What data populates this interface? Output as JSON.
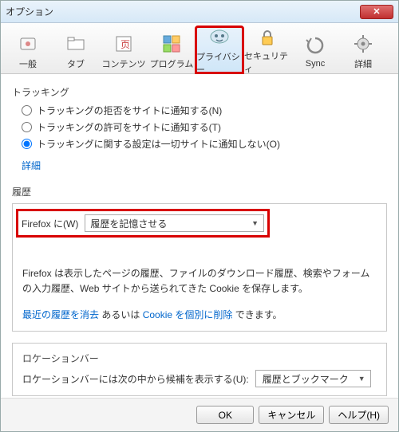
{
  "window": {
    "title": "オプション"
  },
  "tabs": [
    {
      "label": "一般"
    },
    {
      "label": "タブ"
    },
    {
      "label": "コンテンツ"
    },
    {
      "label": "プログラム"
    },
    {
      "label": "プライバシー"
    },
    {
      "label": "セキュリティ"
    },
    {
      "label": "Sync"
    },
    {
      "label": "詳細"
    }
  ],
  "tracking": {
    "title": "トラッキング",
    "opt1": "トラッキングの拒否をサイトに通知する(N)",
    "opt2": "トラッキングの許可をサイトに通知する(T)",
    "opt3": "トラッキングに関する設定は一切サイトに通知しない(O)",
    "details": "詳細"
  },
  "history": {
    "title": "履歴",
    "prefix": "Firefox に(W)",
    "select_value": "履歴を記憶させる",
    "desc": "Firefox は表示したページの履歴、ファイルのダウンロード履歴、検索やフォームの入力履歴、Web サイトから送られてきた Cookie を保存します。",
    "link1": "最近の履歴を消去",
    "link_mid": " あるいは ",
    "link2": "Cookie を個別に削除",
    "link_tail": " できます。"
  },
  "locbar": {
    "title": "ロケーションバー",
    "label": "ロケーションバーには次の中から候補を表示する(U):",
    "select_value": "履歴とブックマーク"
  },
  "buttons": {
    "ok": "OK",
    "cancel": "キャンセル",
    "help": "ヘルプ(H)"
  }
}
